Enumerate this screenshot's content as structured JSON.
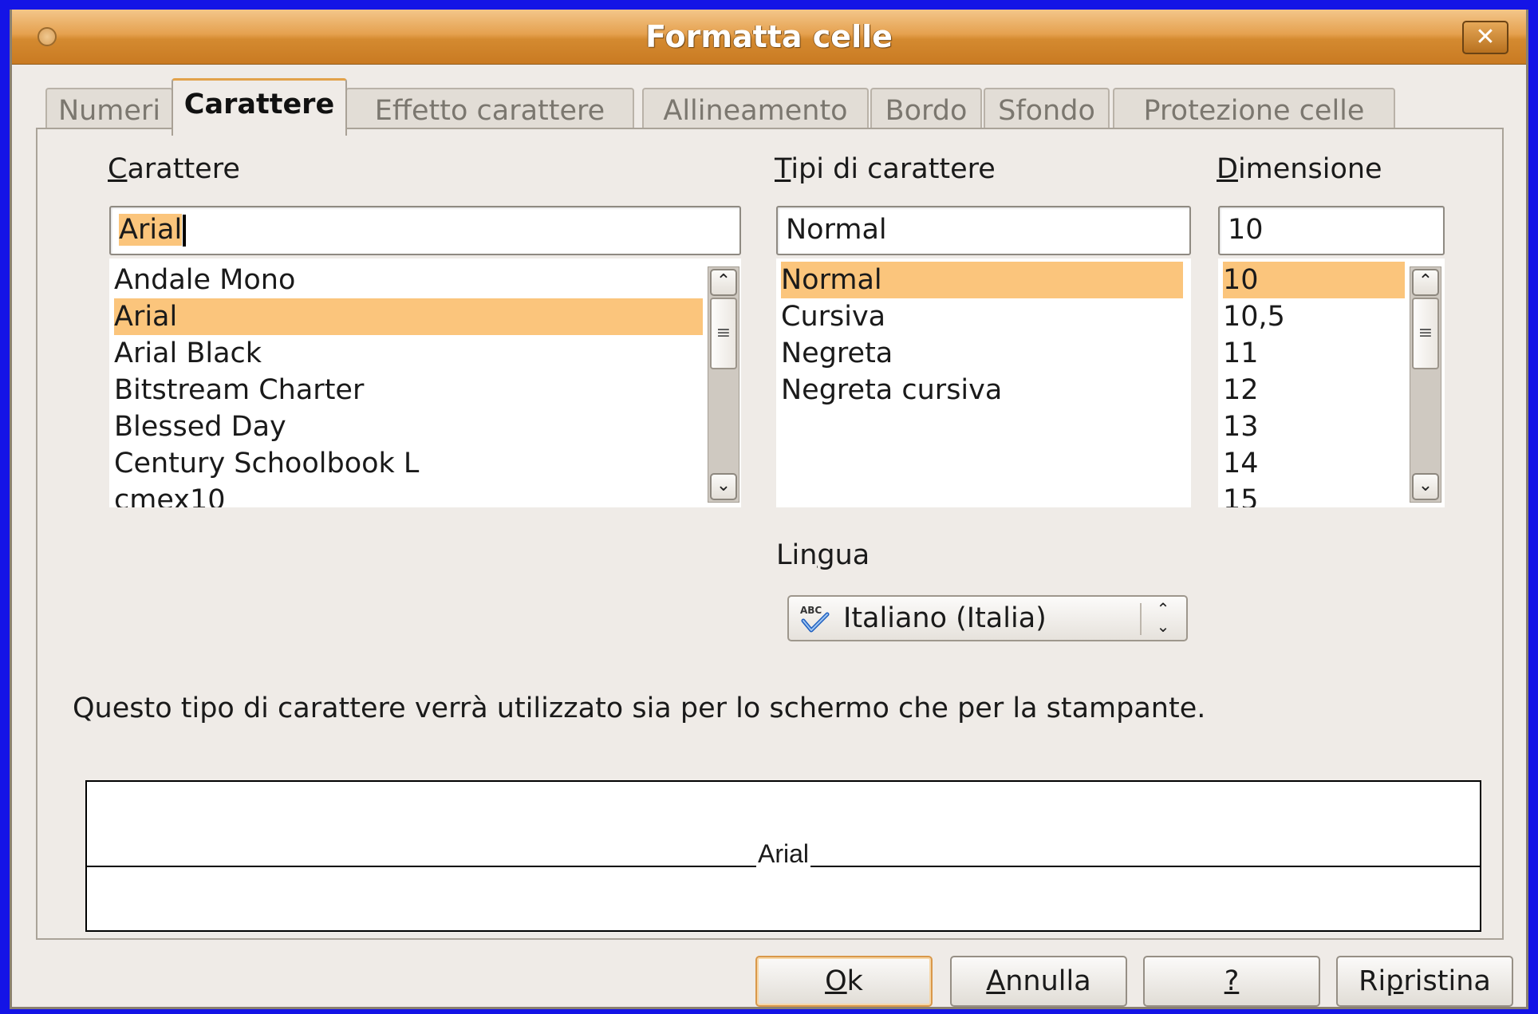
{
  "window": {
    "title": "Formatta celle",
    "close_glyph": "✕"
  },
  "tabs": [
    {
      "label": "Numeri"
    },
    {
      "label": "Carattere",
      "active": true
    },
    {
      "label": "Effetto carattere"
    },
    {
      "label": "Allineamento"
    },
    {
      "label": "Bordo"
    },
    {
      "label": "Sfondo"
    },
    {
      "label": "Protezione celle"
    }
  ],
  "font": {
    "label_mnemonic": "C",
    "label_rest": "arattere",
    "value": "Arial",
    "items": [
      "Andale Mono",
      "Arial",
      "Arial Black",
      "Bitstream Charter",
      "Blessed Day",
      "Century Schoolbook L",
      "cmex10"
    ],
    "selected": "Arial"
  },
  "style": {
    "label_mnemonic": "T",
    "label_rest": "ipi di carattere",
    "value": "Normal",
    "items": [
      "Normal",
      "Cursiva",
      "Negreta",
      "Negreta cursiva"
    ],
    "selected": "Normal"
  },
  "size": {
    "label_mnemonic": "D",
    "label_rest": "imensione",
    "value": "10",
    "items": [
      "10",
      "10,5",
      "11",
      "12",
      "13",
      "14",
      "15"
    ],
    "selected": "10"
  },
  "language": {
    "label_pre": "Lin",
    "label_mnemonic": "g",
    "label_post": "ua",
    "value": "Italiano (Italia)",
    "icon": "spellcheck-icon"
  },
  "info_text": "Questo tipo di carattere verrà utilizzato sia per lo schermo che per la stampante.",
  "preview_text": "Arial",
  "buttons": {
    "ok_mnemonic": "O",
    "ok_rest": "k",
    "cancel_mnemonic": "A",
    "cancel_rest": "nnulla",
    "help_mnemonic": "?",
    "reset_pre": "Ri",
    "reset_mnemonic": "p",
    "reset_post": "ristina"
  },
  "colors": {
    "accent": "#fbc57c",
    "titlebar": "#d48a30",
    "desktop": "#1414e6"
  }
}
